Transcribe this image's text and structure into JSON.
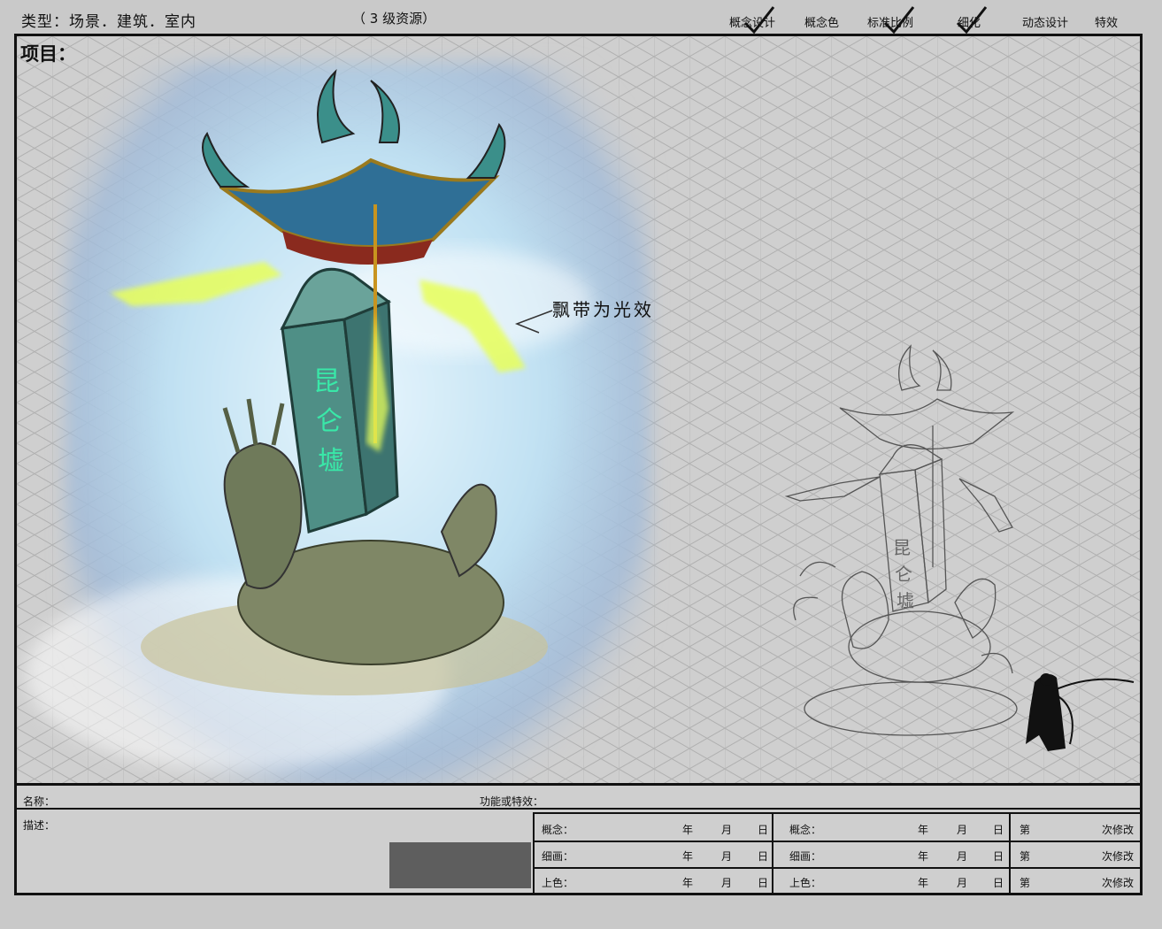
{
  "header": {
    "type_label": "类型：场景．建筑．室内",
    "level_label": "（   3   级资源）",
    "stages": [
      {
        "label": "概念设计",
        "checked": true
      },
      {
        "label": "概念色",
        "checked": false
      },
      {
        "label": "标准比例",
        "checked": true
      },
      {
        "label": "细化",
        "checked": true
      },
      {
        "label": "动态设计",
        "checked": false
      },
      {
        "label": "特效",
        "checked": false
      }
    ]
  },
  "main": {
    "project_label": "项目：",
    "annotation": "飘带为光效",
    "stele_text": "昆仑墟"
  },
  "form": {
    "name_label": "名称：",
    "function_label": "功能或特效：",
    "description_label": "描述：",
    "schedule_a": [
      {
        "label": "概念：",
        "year": "年",
        "month": "月",
        "day": "日"
      },
      {
        "label": "细画：",
        "year": "年",
        "month": "月",
        "day": "日"
      },
      {
        "label": "上色：",
        "year": "年",
        "month": "月",
        "day": "日"
      }
    ],
    "schedule_b": [
      {
        "label": "概念：",
        "year": "年",
        "month": "月",
        "day": "日"
      },
      {
        "label": "细画：",
        "year": "年",
        "month": "月",
        "day": "日"
      },
      {
        "label": "上色：",
        "year": "年",
        "month": "月",
        "day": "日"
      }
    ],
    "revisions": [
      {
        "prefix": "第",
        "suffix": "次修改"
      },
      {
        "prefix": "第",
        "suffix": "次修改"
      },
      {
        "prefix": "第",
        "suffix": "次修改"
      }
    ]
  },
  "colors": {
    "frame": "#111111",
    "background": "#c9c9c9",
    "sky": "#bfe0f2",
    "roof": "#2f6f96",
    "jade": "#4f8f86",
    "glow": "#e8ff5a",
    "glyph": "#39e8a8",
    "form_block": "#5e5e5e"
  }
}
